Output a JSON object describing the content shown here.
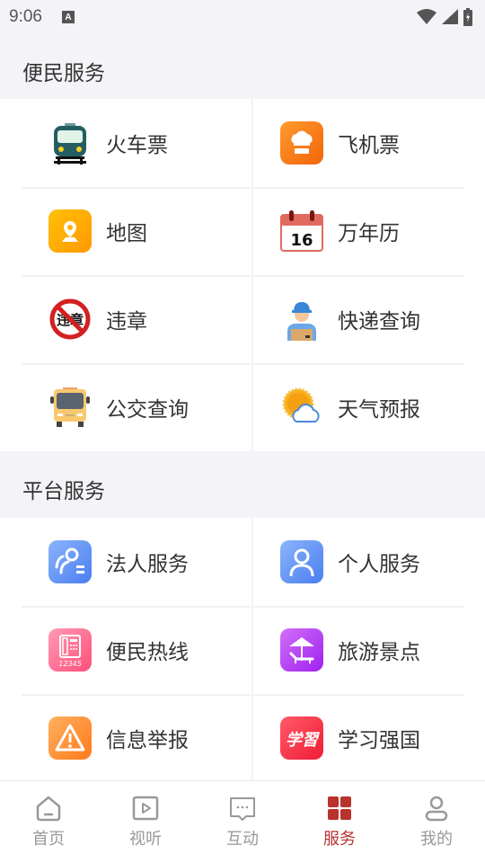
{
  "status_bar": {
    "time": "9:06",
    "notification_icon_text": "A"
  },
  "sections": [
    {
      "title": "便民服务",
      "items": [
        {
          "label": "火车票",
          "icon": "train-icon"
        },
        {
          "label": "飞机票",
          "icon": "chef-hat-icon"
        },
        {
          "label": "地图",
          "icon": "map-pin-icon"
        },
        {
          "label": "万年历",
          "icon": "calendar-icon",
          "calendar_day": "16"
        },
        {
          "label": "违章",
          "icon": "traffic-violation-icon",
          "icon_text": "违章"
        },
        {
          "label": "快递查询",
          "icon": "courier-icon"
        },
        {
          "label": "公交查询",
          "icon": "bus-icon"
        },
        {
          "label": "天气预报",
          "icon": "weather-icon"
        }
      ]
    },
    {
      "title": "平台服务",
      "items": [
        {
          "label": "法人服务",
          "icon": "corporate-service-icon"
        },
        {
          "label": "个人服务",
          "icon": "personal-service-icon"
        },
        {
          "label": "便民热线",
          "icon": "hotline-phone-icon",
          "icon_text": "12345"
        },
        {
          "label": "旅游景点",
          "icon": "beach-umbrella-icon"
        },
        {
          "label": "信息举报",
          "icon": "warning-icon"
        },
        {
          "label": "学习强国",
          "icon": "xuexi-icon",
          "icon_text": "学習"
        }
      ]
    }
  ],
  "bottom_nav": {
    "active_index": 3,
    "active_color": "#b8322e",
    "inactive_color": "#999999",
    "items": [
      {
        "label": "首页",
        "icon": "home-icon"
      },
      {
        "label": "视听",
        "icon": "video-play-icon"
      },
      {
        "label": "互动",
        "icon": "chat-bubble-icon"
      },
      {
        "label": "服务",
        "icon": "grid-icon"
      },
      {
        "label": "我的",
        "icon": "user-icon"
      }
    ]
  }
}
